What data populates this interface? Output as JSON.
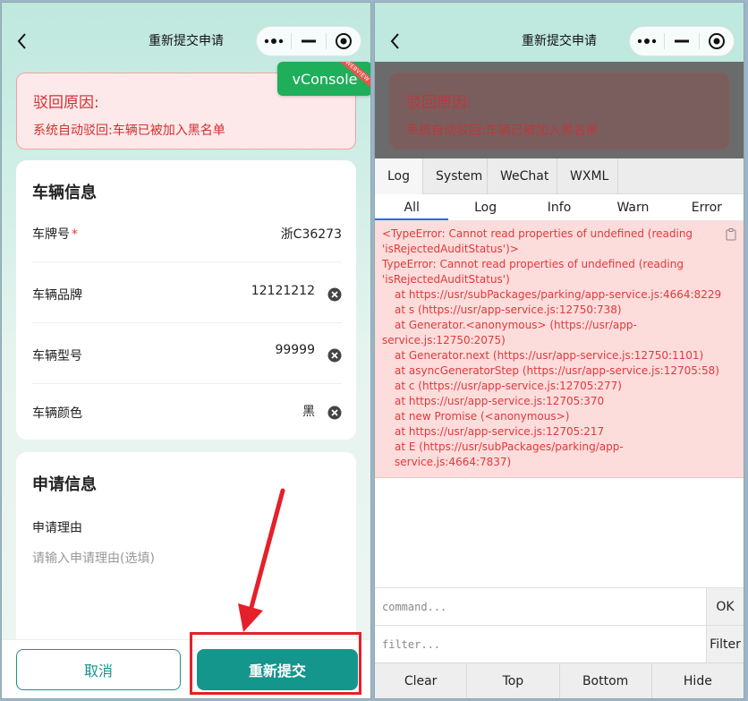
{
  "page_title": "重新提交申请",
  "reject": {
    "title": "驳回原因:",
    "message": "系统自动驳回:车辆已被加入黑名单"
  },
  "vconsole_button": {
    "label": "vConsole",
    "ribbon": "WEBVIEW"
  },
  "vehicle_info": {
    "title": "车辆信息",
    "rows": [
      {
        "label": "车牌号",
        "value": "浙C36273"
      },
      {
        "label": "车辆品牌",
        "value": "12121212"
      },
      {
        "label": "车辆型号",
        "value": "99999"
      },
      {
        "label": "车辆颜色",
        "value": "黑"
      }
    ]
  },
  "apply_info": {
    "title": "申请信息",
    "reason_label": "申请理由",
    "reason_placeholder": "请输入申请理由(选填)"
  },
  "buttons": {
    "cancel": "取消",
    "resubmit": "重新提交"
  },
  "vconsole": {
    "tabs": [
      "Log",
      "System",
      "WeChat",
      "WXML"
    ],
    "subtabs": [
      "All",
      "Log",
      "Info",
      "Warn",
      "Error"
    ],
    "log_lines": [
      "<TypeError: Cannot read properties of undefined (reading 'isRejectedAuditStatus')>",
      "TypeError: Cannot read properties of undefined (reading 'isRejectedAuditStatus')",
      "at https://usr/subPackages/parking/app-service.js:4664:8229",
      "at s (https://usr/app-service.js:12750:738)",
      "at Generator.<anonymous> (https://usr/app-service.js:12750:2075)",
      "at Generator.next (https://usr/app-service.js:12750:1101)",
      "at asyncGeneratorStep (https://usr/app-service.js:12705:58)",
      "at c (https://usr/app-service.js:12705:277)",
      "at https://usr/app-service.js:12705:370",
      "at new Promise (<anonymous>)",
      "at https://usr/app-service.js:12705:217",
      "at E (https://usr/subPackages/parking/app-service.js:4664:7837)"
    ],
    "command_placeholder": "command...",
    "command_button": "OK",
    "filter_placeholder": "filter...",
    "filter_button": "Filter",
    "footer": [
      "Clear",
      "Top",
      "Bottom",
      "Hide"
    ]
  },
  "colors": {
    "primary": "#14968c",
    "error": "#e03a3a",
    "vconsole_green": "#1fae5a",
    "annotation_red": "#e5202a"
  }
}
